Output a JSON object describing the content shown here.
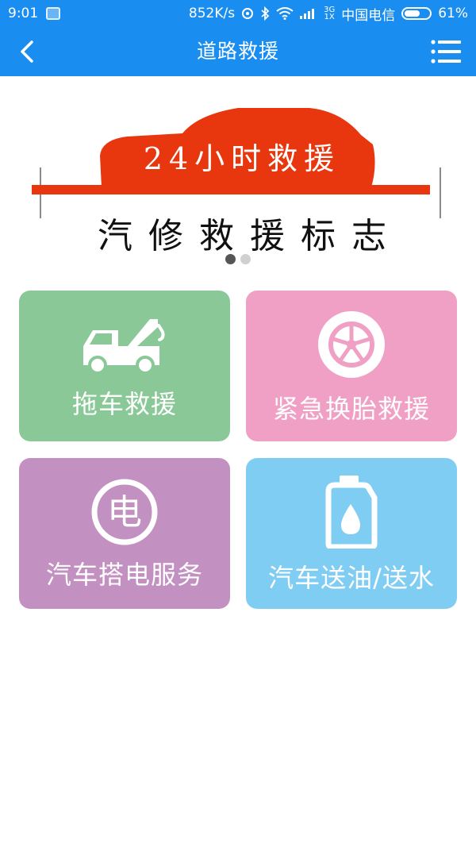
{
  "status_bar": {
    "time": "9:01",
    "speed": "852K/s",
    "network_top": "3G",
    "network_bottom": "1X",
    "carrier": "中国电信",
    "battery": "61%",
    "battery_level": 0.61
  },
  "header": {
    "title": "道路救援",
    "back_icon": "chevron-left-icon",
    "menu_icon": "list-menu-icon"
  },
  "banner": {
    "headline": "24小时救援",
    "subline": "汽修救援标志",
    "accent_color": "#e8370e",
    "slide_count": 2,
    "active_slide": 1
  },
  "services": [
    {
      "label": "拖车救援",
      "icon": "tow-truck-icon",
      "color": "#8ac897"
    },
    {
      "label": "紧急换胎救援",
      "icon": "tire-icon",
      "color": "#f0a0c4"
    },
    {
      "label": "汽车搭电服务",
      "icon": "electric-icon",
      "color": "#c391c1"
    },
    {
      "label": "汽车送油/送水",
      "icon": "fuel-can-icon",
      "color": "#80cdf3"
    }
  ],
  "theme": {
    "primary": "#1a8ef0"
  }
}
